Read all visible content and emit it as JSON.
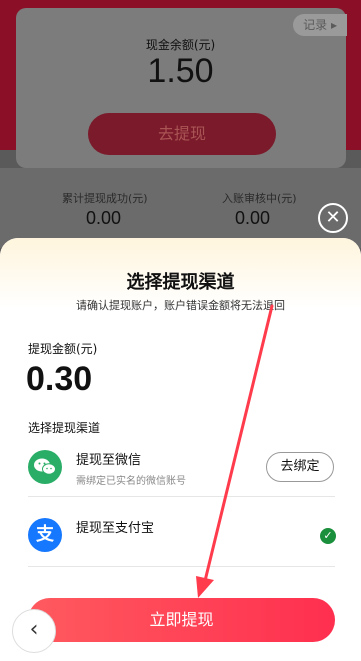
{
  "background": {
    "record_label": "记录",
    "balance_label": "现金余额(元)",
    "balance_value": "1.50",
    "withdraw_button": "去提现",
    "stat_total_label": "累计提现成功(元)",
    "stat_total_value": "0.00",
    "stat_pending_label": "入账审核中(元)",
    "stat_pending_value": "0.00"
  },
  "close_icon": "✕",
  "sheet": {
    "title": "选择提现渠道",
    "subtitle": "请确认提现账户，账户错误金额将无法退回",
    "amount_label": "提现金额(元)",
    "amount_value": "0.30",
    "channel_label": "选择提现渠道",
    "channels": [
      {
        "title": "提现至微信",
        "desc": "需绑定已实名的微信账号",
        "action_label": "去绑定",
        "icon": "wechat-icon"
      },
      {
        "title": "提现至支付宝",
        "desc": "",
        "icon": "alipay-icon",
        "icon_glyph": "支",
        "selected": true
      }
    ],
    "submit_label": "立即提现",
    "back_icon": "‹"
  },
  "colors": {
    "primary_red": "#ff2f4f",
    "wechat_green": "#2aae67",
    "alipay_blue": "#1678ff",
    "annotation_arrow": "#ff3b4c"
  }
}
